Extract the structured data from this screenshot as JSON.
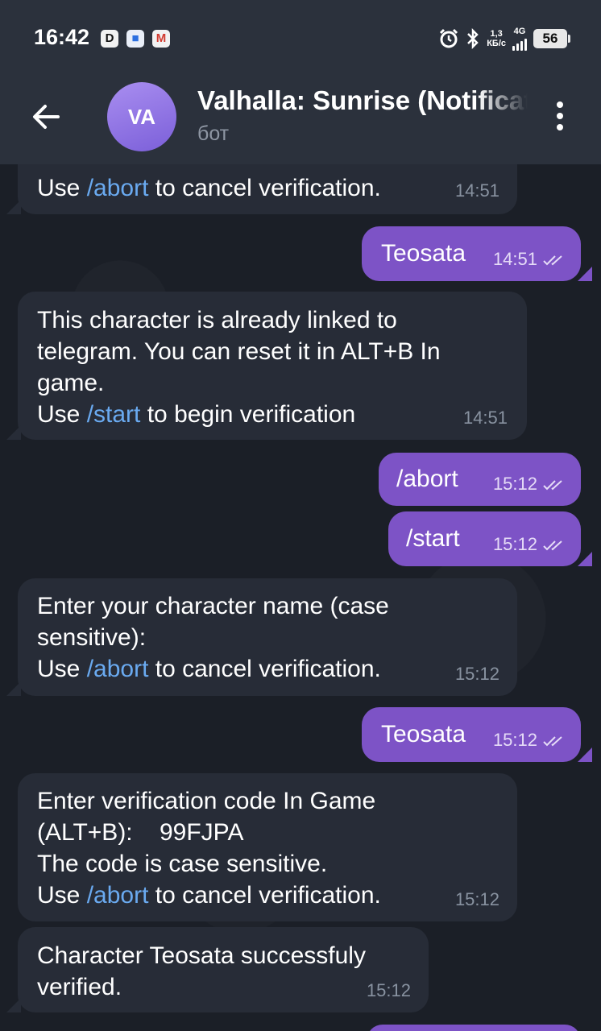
{
  "status_bar": {
    "time": "16:42",
    "notif_icons": [
      "D",
      "■",
      "M"
    ],
    "speed_top": "1,3",
    "speed_bottom": "КБ/с",
    "network": "4G",
    "battery": "56"
  },
  "header": {
    "avatar_initials": "VA",
    "title": "Valhalla: Sunrise (Notifications)",
    "subtitle": "бот"
  },
  "messages": [
    {
      "dir": "in",
      "pre": "Use ",
      "cmd": "/abort",
      "post": " to cancel verification.",
      "time": "14:51"
    },
    {
      "dir": "out",
      "text": "Teosata",
      "time": "14:51"
    },
    {
      "dir": "in",
      "pre": "This character is already linked to\ntelegram. You can reset it in ALT+B In\ngame.\nUse ",
      "cmd": "/start",
      "post": " to begin verification",
      "time": "14:51"
    },
    {
      "dir": "out",
      "text": "/abort",
      "time": "15:12"
    },
    {
      "dir": "out",
      "text": "/start",
      "time": "15:12"
    },
    {
      "dir": "in",
      "pre": "Enter your character name (case\nsensitive):\nUse ",
      "cmd": "/abort",
      "post": " to cancel verification.",
      "time": "15:12"
    },
    {
      "dir": "out",
      "text": "Teosata",
      "time": "15:12"
    },
    {
      "dir": "in",
      "pre": "Enter verification code In Game\n(ALT+B):    99FJPA\nThe code is case sensitive.\nUse ",
      "cmd": "/abort",
      "post": " to cancel verification.",
      "time": "15:12"
    },
    {
      "dir": "in",
      "pre": "Character Teosata successfuly\nverified.",
      "cmd": "",
      "post": "",
      "time": "15:12"
    }
  ],
  "colors": {
    "incoming_bubble": "#272c37",
    "outgoing_bubble": "#7d53c6",
    "command_link": "#6aaaf0",
    "header_bg": "#2b313c"
  },
  "icons": [
    "back-arrow-icon",
    "more-vertical-icon",
    "double-check-icon",
    "alarm-icon",
    "bluetooth-icon",
    "signal-icon",
    "battery-icon"
  ]
}
